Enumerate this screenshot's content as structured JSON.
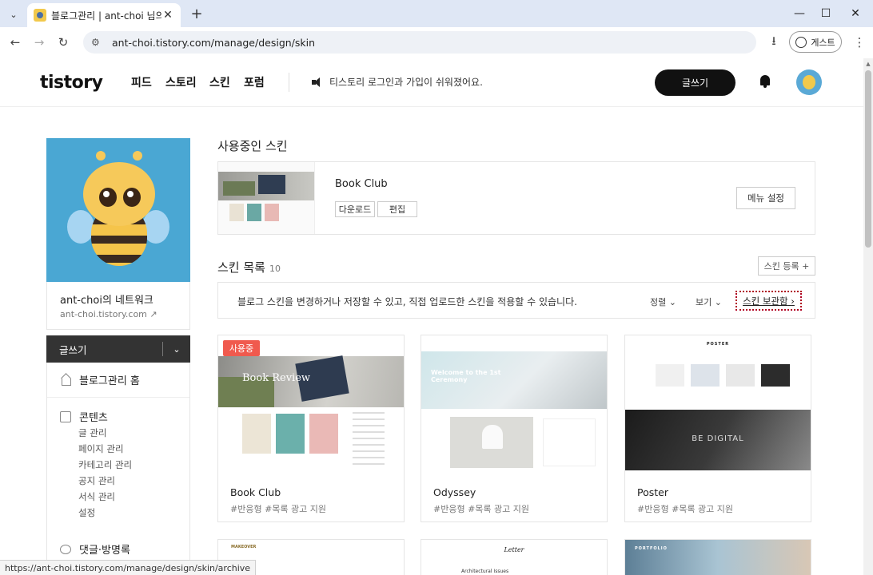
{
  "browser": {
    "tab_title": "블로그관리 | ant-choi 님의 블로그",
    "url": "ant-choi.tistory.com/manage/design/skin",
    "guest_label": "게스트",
    "status_url": "https://ant-choi.tistory.com/manage/design/skin/archive"
  },
  "header": {
    "logo": "tistory",
    "nav": [
      "피드",
      "스토리",
      "스킨",
      "포럼"
    ],
    "notice": "티스토리 로그인과 가입이 쉬워졌어요.",
    "write_label": "글쓰기"
  },
  "sidebar": {
    "blog_name": "ant-choi의 네트워크",
    "blog_url": "ant-choi.tistory.com",
    "write_label": "글쓰기",
    "home_label": "블로그관리 홈",
    "contents_label": "콘텐츠",
    "contents_items": [
      "글 관리",
      "페이지 관리",
      "카테고리 관리",
      "공지 관리",
      "서식 관리",
      "설정"
    ],
    "comments_label": "댓글·방명록"
  },
  "main": {
    "current_title": "사용중인 스킨",
    "current_skin": {
      "name": "Book Club",
      "download_label": "다운로드",
      "edit_label": "편집",
      "menu_settings_label": "메뉴 설정"
    },
    "list_title": "스킨 목록",
    "list_count": "10",
    "register_label": "스킨 등록 +",
    "info_text": "블로그 스킨을 변경하거나 저장할 수 있고, 직접 업로드한 스킨을 적용할 수 있습니다.",
    "sort_label": "정렬",
    "view_label": "보기",
    "archive_label": "스킨 보관함",
    "in_use_badge": "사용중",
    "cards": [
      {
        "name": "Book Club",
        "tags": "#반응형  #목록 광고 지원",
        "thumb_text": "Book Review"
      },
      {
        "name": "Odyssey",
        "tags": "#반응형  #목록 광고 지원",
        "thumb_text": "Welcome to the 1st Ceremony"
      },
      {
        "name": "Poster",
        "tags": "#반응형  #목록 광고 지원",
        "thumb_text": "BE DIGITAL",
        "thumb_header": "POSTER"
      }
    ],
    "next_cards": [
      {
        "thumb_text": "MAKEOVER"
      },
      {
        "thumb_text": "Letter",
        "thumb_sub": "Architectural Issues"
      },
      {
        "thumb_text": "PORTFOLIO"
      }
    ]
  },
  "colors": {
    "accent_dark": "#111111",
    "in_use_red": "#f05a4e",
    "archive_outline": "#b00020"
  }
}
